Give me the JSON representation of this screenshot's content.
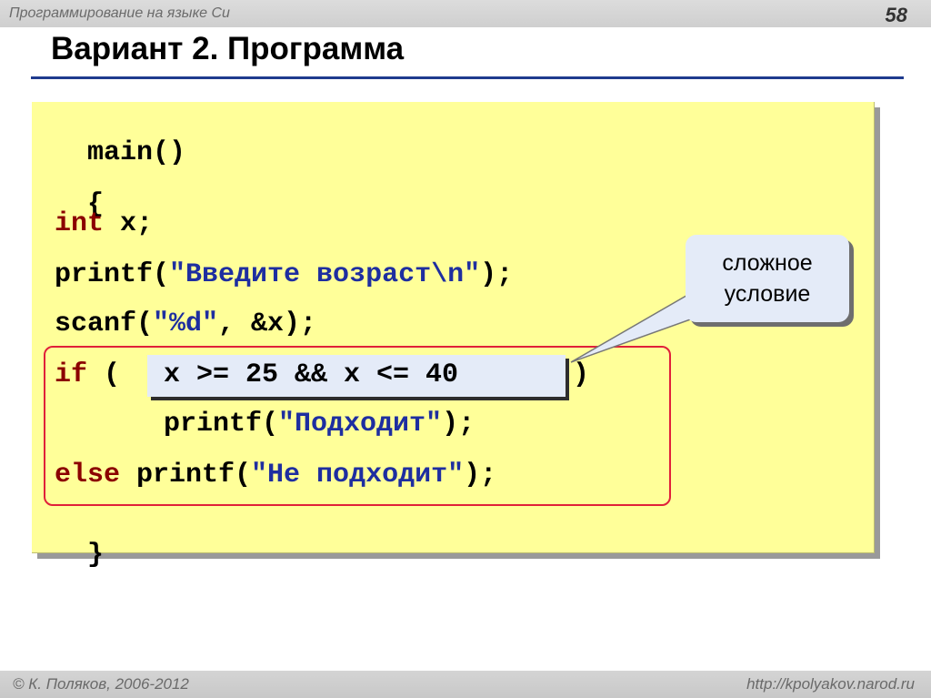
{
  "header": {
    "course": "Программирование на языке Си",
    "page_number": "58"
  },
  "slide": {
    "title": "Вариант 2. Программа"
  },
  "code": {
    "l1": "main()",
    "l2": "{",
    "l3_kw": "int",
    "l3_rest": " x;",
    "l4_pre": "printf(",
    "l4_str": "\"Введите возраст\\n\"",
    "l4_post": ");",
    "l5_pre": "scanf(",
    "l5_str": "\"%d\"",
    "l5_post": ", &x);",
    "l6_kw": "if",
    "l6_open": " (",
    "l6_cond": "x >= 25 && x <= 40",
    "l6_close": ")",
    "l7_pre": "printf(",
    "l7_str": "\"Подходит\"",
    "l7_post": ");",
    "l8_kw": "else",
    "l8_pre": " printf(",
    "l8_str": "\"Не подходит\"",
    "l8_post": ");",
    "l9": "}"
  },
  "callout": {
    "line1": "сложное",
    "line2": "условие"
  },
  "footer": {
    "author": "© К. Поляков, 2006-2012",
    "url": "http://kpolyakov.narod.ru"
  },
  "colors": {
    "code_background": "#ffff99",
    "keyword": "#8b0000",
    "string": "#1e2ea0",
    "highlight_frame": "#e0203a",
    "title_rule": "#1f3b8e",
    "callout_fill": "#e4ebf8"
  }
}
